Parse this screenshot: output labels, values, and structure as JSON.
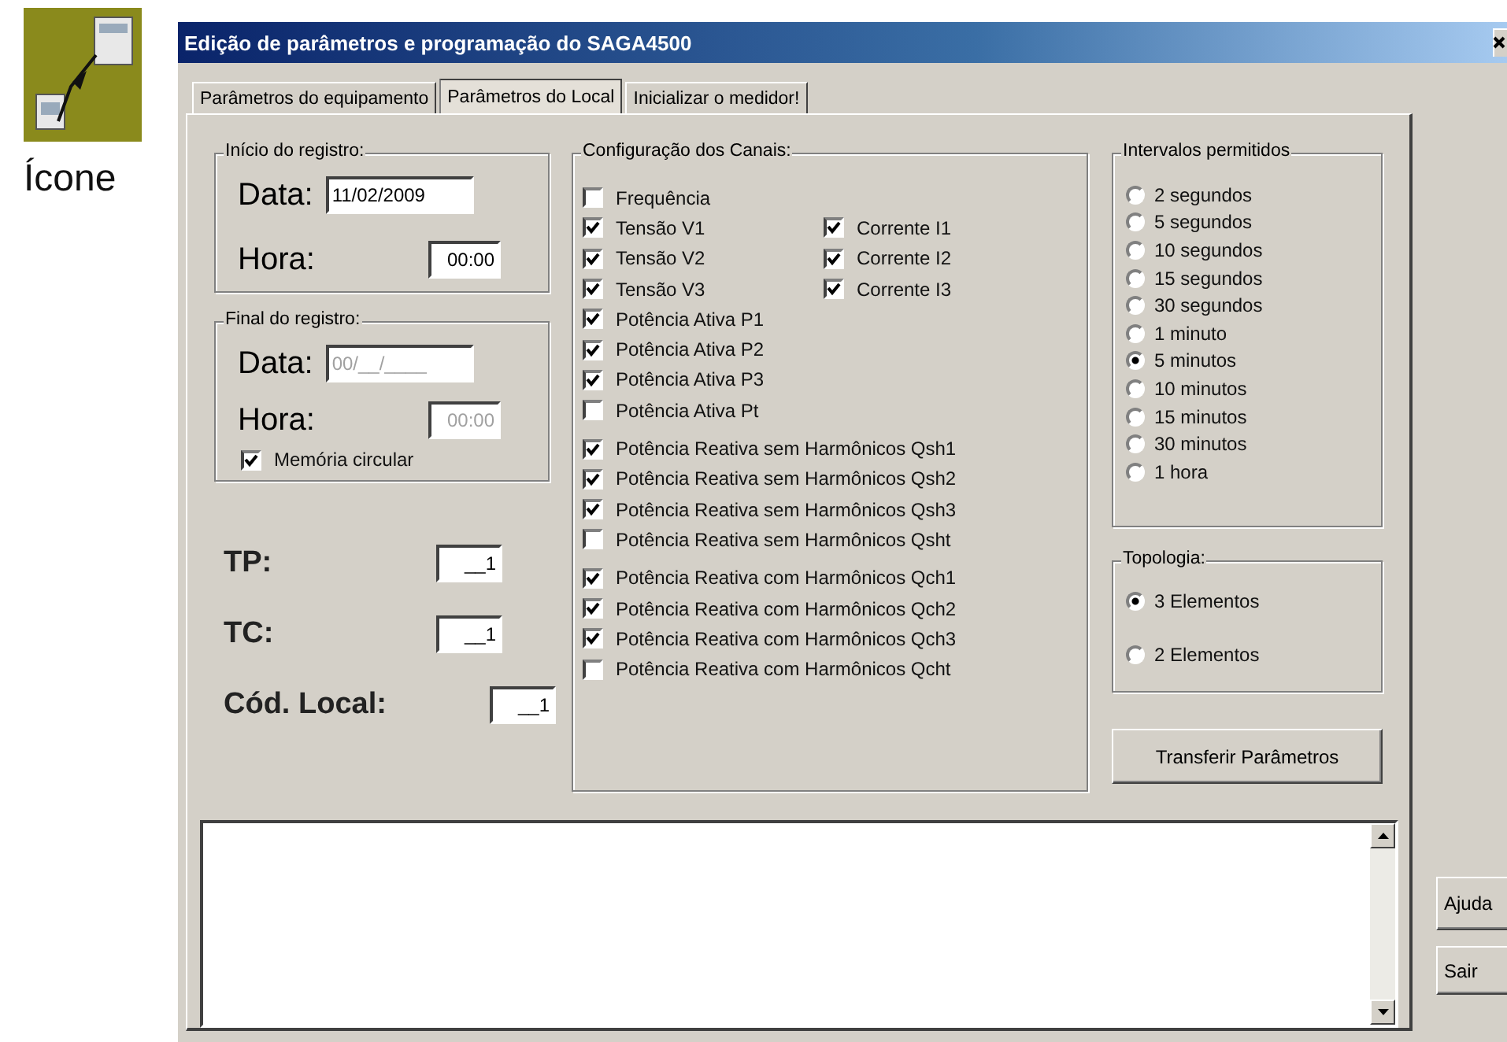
{
  "side": {
    "caption": "Ícone"
  },
  "window": {
    "title": "Edição de parâmetros e programação do SAGA4500"
  },
  "tabs": [
    {
      "label": "Parâmetros do equipamento",
      "selected": false
    },
    {
      "label": "Parâmetros do Local",
      "selected": true
    },
    {
      "label": "Inicializar o medidor!",
      "selected": false
    }
  ],
  "record_start": {
    "legend": "Início do registro:",
    "fields": [
      {
        "label": "Data:",
        "value": "11/02/2009",
        "kind": "date",
        "disabled": false
      },
      {
        "label": "Hora:",
        "value": "00:00",
        "kind": "time",
        "disabled": false
      }
    ]
  },
  "record_end": {
    "legend": "Final do registro:",
    "fields": [
      {
        "label": "Data:",
        "value": "00/__/____",
        "kind": "date",
        "disabled": true
      },
      {
        "label": "Hora:",
        "value": "00:00",
        "kind": "time",
        "disabled": true
      }
    ],
    "circular_memory": {
      "label": "Memória circular",
      "checked": true
    }
  },
  "factors": [
    {
      "label": "TP:",
      "value": "__1"
    },
    {
      "label": "TC:",
      "value": "__1"
    },
    {
      "label": "Cód. Local:",
      "value": "__1"
    }
  ],
  "channels": {
    "legend": "Configuração dos Canais:",
    "groups": [
      [
        [
          {
            "label": "Frequência",
            "checked": false
          }
        ],
        [
          {
            "label": "Tensão V1",
            "checked": true
          },
          {
            "label": "Corrente I1",
            "checked": true
          }
        ],
        [
          {
            "label": "Tensão V2",
            "checked": true
          },
          {
            "label": "Corrente I2",
            "checked": true
          }
        ],
        [
          {
            "label": "Tensão V3",
            "checked": true
          },
          {
            "label": "Corrente I3",
            "checked": true
          }
        ],
        [
          {
            "label": "Potência Ativa P1",
            "checked": true
          }
        ],
        [
          {
            "label": "Potência Ativa P2",
            "checked": true
          }
        ],
        [
          {
            "label": "Potência Ativa P3",
            "checked": true
          }
        ],
        [
          {
            "label": "Potência Ativa Pt",
            "checked": false
          }
        ]
      ],
      [
        [
          {
            "label": "Potência Reativa sem Harmônicos Qsh1",
            "checked": true
          }
        ],
        [
          {
            "label": "Potência Reativa sem Harmônicos Qsh2",
            "checked": true
          }
        ],
        [
          {
            "label": "Potência Reativa sem Harmônicos Qsh3",
            "checked": true
          }
        ],
        [
          {
            "label": "Potência Reativa sem Harmônicos Qsht",
            "checked": false
          }
        ]
      ],
      [
        [
          {
            "label": "Potência Reativa com Harmônicos Qch1",
            "checked": true
          }
        ],
        [
          {
            "label": "Potência Reativa com Harmônicos Qch2",
            "checked": true
          }
        ],
        [
          {
            "label": "Potência Reativa com Harmônicos Qch3",
            "checked": true
          }
        ],
        [
          {
            "label": "Potência Reativa com Harmônicos Qcht",
            "checked": false
          }
        ]
      ]
    ]
  },
  "intervals": {
    "legend": "Intervalos permitidos",
    "options": [
      {
        "label": "2 segundos",
        "selected": false
      },
      {
        "label": "5 segundos",
        "selected": false
      },
      {
        "label": "10 segundos",
        "selected": false
      },
      {
        "label": "15 segundos",
        "selected": false
      },
      {
        "label": "30 segundos",
        "selected": false
      },
      {
        "label": "1 minuto",
        "selected": false
      },
      {
        "label": "5 minutos",
        "selected": true
      },
      {
        "label": "10 minutos",
        "selected": false
      },
      {
        "label": "15 minutos",
        "selected": false
      },
      {
        "label": "30 minutos",
        "selected": false
      },
      {
        "label": "1 hora",
        "selected": false
      }
    ]
  },
  "topology": {
    "legend": "Topologia:",
    "options": [
      {
        "label": "3 Elementos",
        "selected": true
      },
      {
        "label": "2 Elementos",
        "selected": false
      }
    ]
  },
  "transfer_button": "Transferir Parâmetros",
  "buttons": [
    "Ajuda",
    "Sair"
  ]
}
